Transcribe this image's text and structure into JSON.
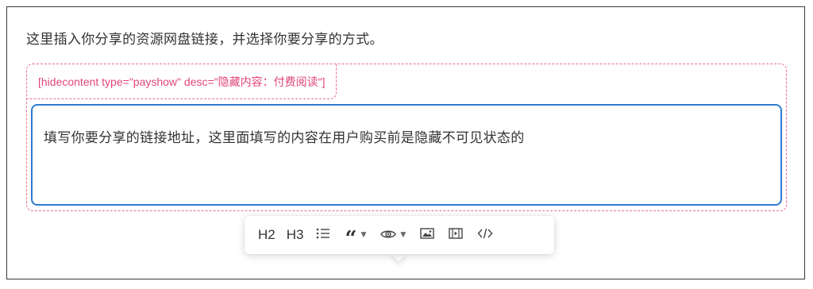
{
  "intro": {
    "text": "这里插入你分享的资源网盘链接，并选择你要分享的方式。"
  },
  "shortcode": {
    "tag_text": "[hidecontent type=\"payshow\" desc=\"隐藏内容：付费阅读\"]",
    "content_text": "填写你要分享的链接地址，这里面填写的内容在用户购买前是隐藏不可见状态的"
  },
  "toolbar": {
    "h2_label": "H2",
    "h3_label": "H3",
    "icons": [
      "list-icon",
      "quote-icon",
      "eye-icon",
      "image-icon",
      "video-icon",
      "code-icon"
    ],
    "caret_glyph": "▼"
  },
  "colors": {
    "accent_blue": "#2d7bd0",
    "shortcode_pink": "#e0457b",
    "dashed_border_pink": "#ec6c98",
    "text_dark": "#333333"
  }
}
